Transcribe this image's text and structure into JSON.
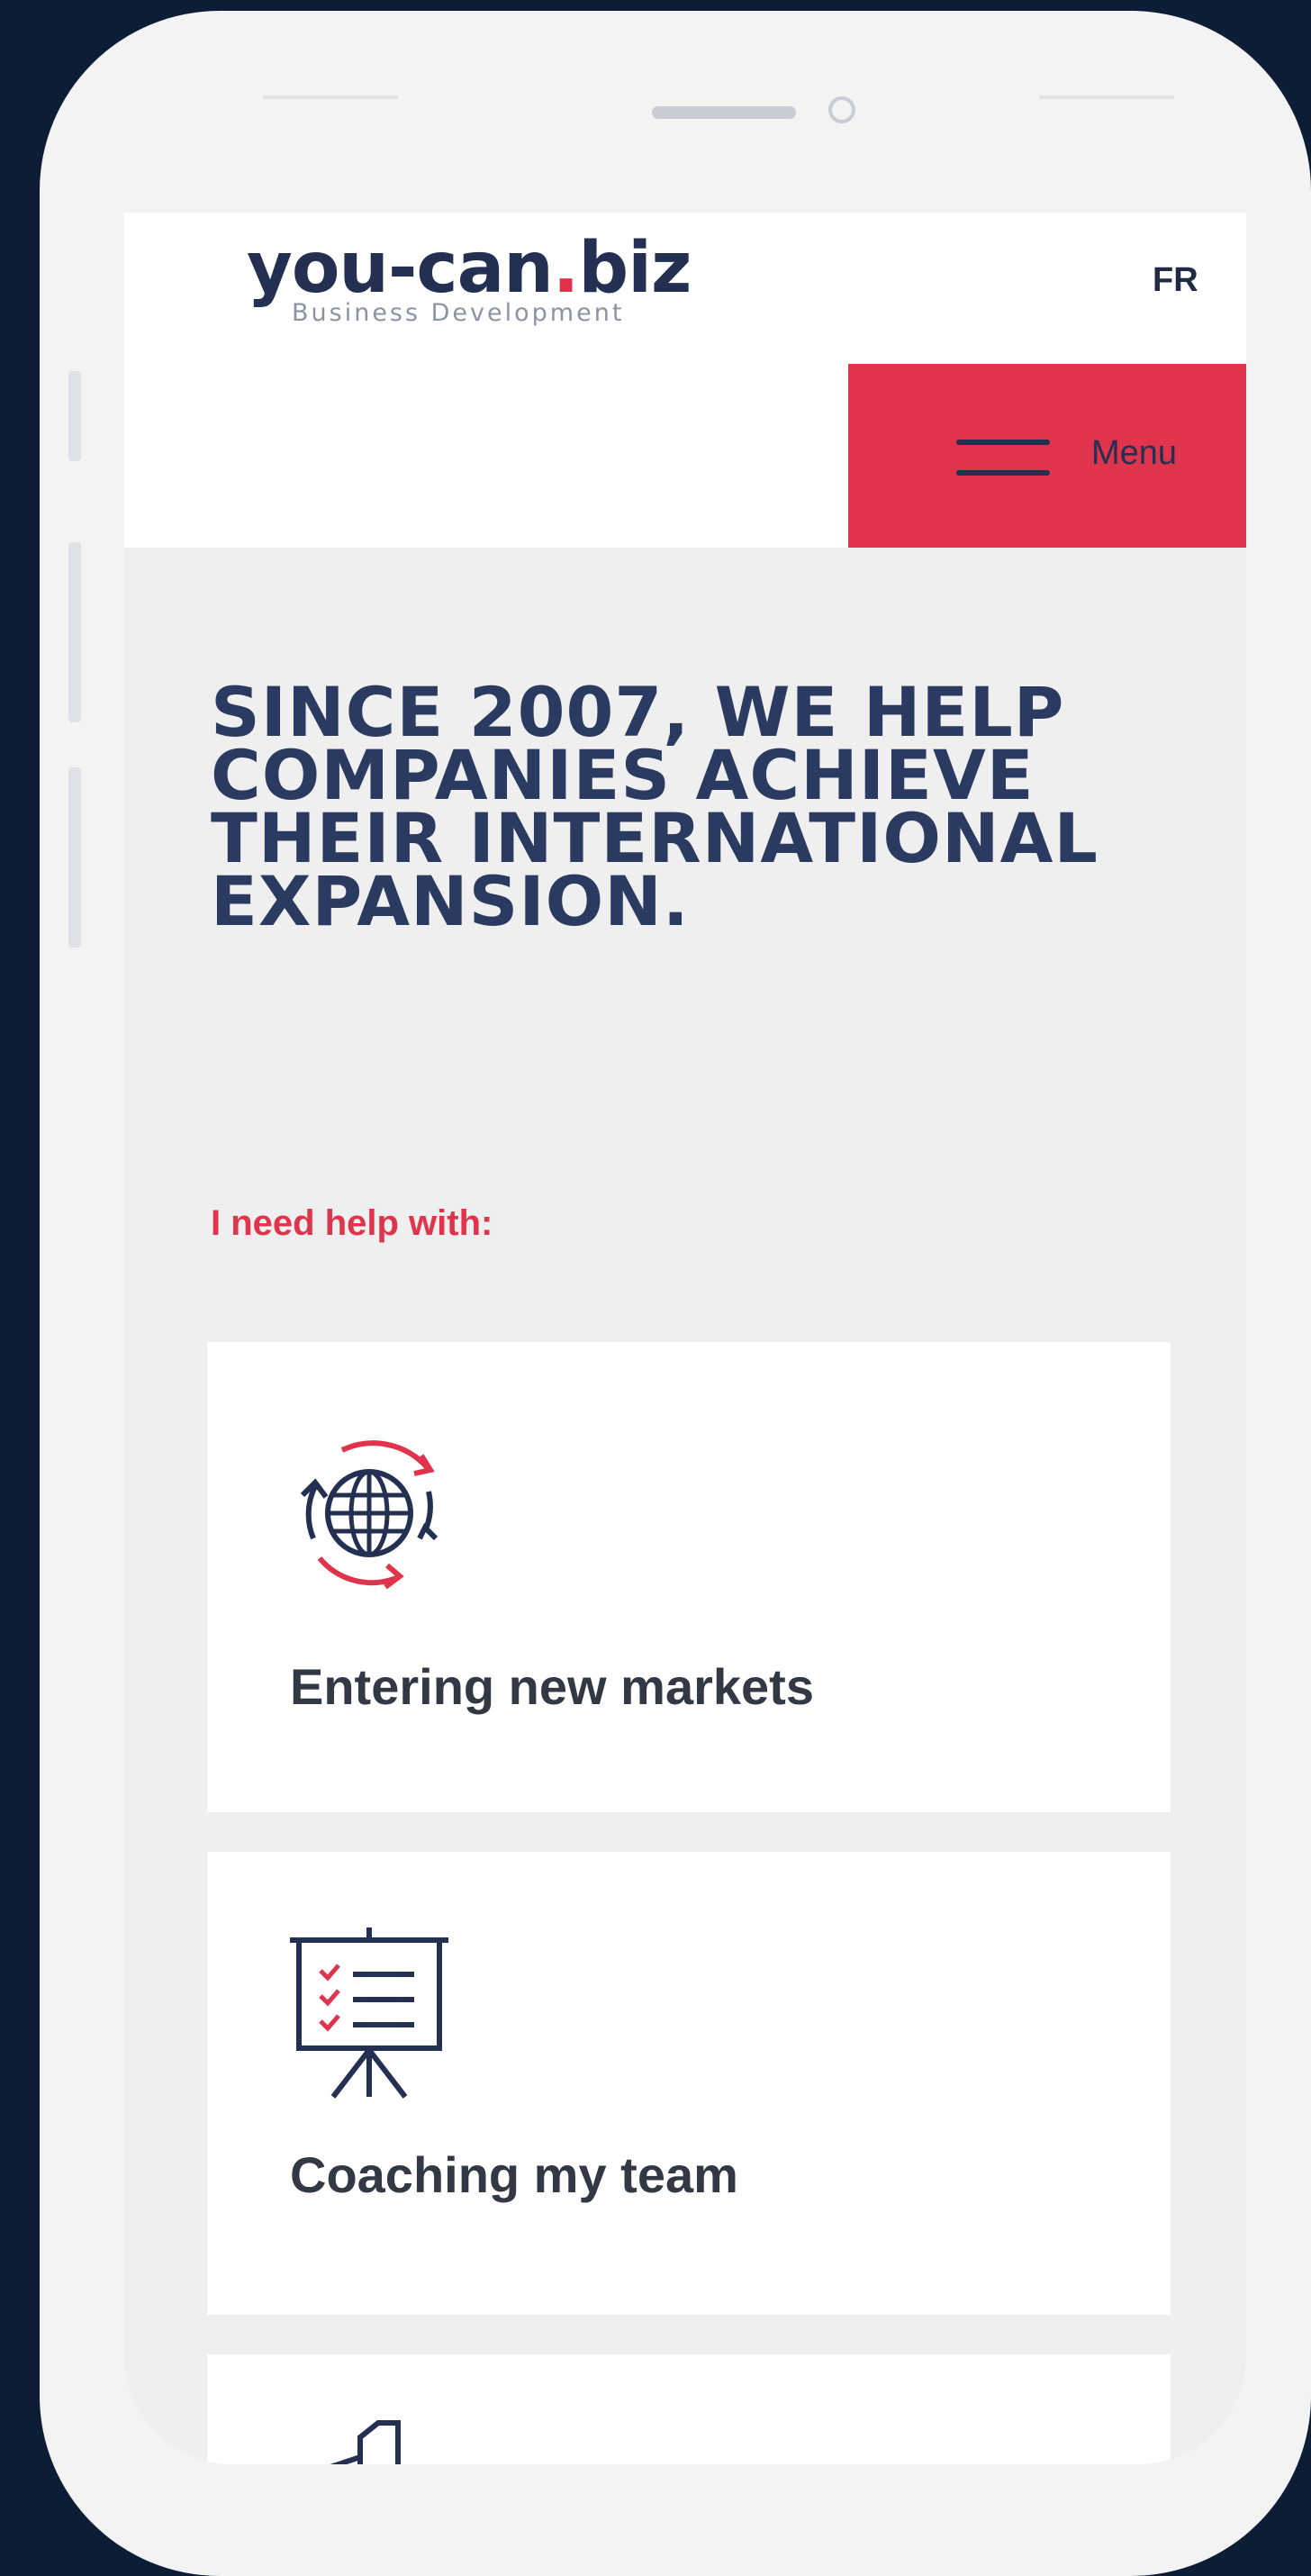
{
  "header": {
    "logo_main": "you-can",
    "logo_dot": ".",
    "logo_tld": "biz",
    "logo_sub": "Business Development",
    "lang_label": "FR",
    "menu_label": "Menu"
  },
  "hero": {
    "title": "SINCE 2007, WE HELP COMPANIES ACHIEVE THEIR INTERNATIONAL EXPANSION."
  },
  "help": {
    "label": "I need help with:",
    "cards": [
      {
        "label": "Entering new markets",
        "icon": "globe-arrows-icon"
      },
      {
        "label": "Coaching my team",
        "icon": "presentation-board-icon"
      },
      {
        "label": "",
        "icon": "buildings-icon"
      }
    ]
  },
  "colors": {
    "accent": "#e0344c",
    "navy": "#233052",
    "page_bg": "#efefef",
    "frame_bg": "#0d1d36"
  }
}
